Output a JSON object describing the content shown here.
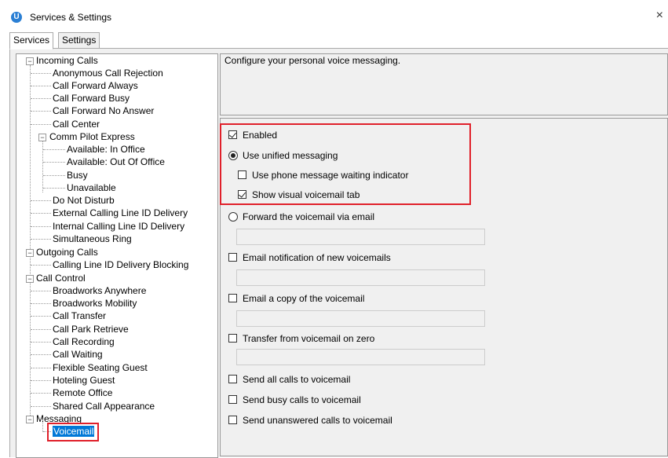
{
  "window": {
    "title": "Services & Settings",
    "icon": "app-logo-icon",
    "close_glyph": "×"
  },
  "tabs": [
    {
      "label": "Services",
      "active": true
    },
    {
      "label": "Settings",
      "active": false
    }
  ],
  "tree": {
    "incoming": {
      "label": "Incoming Calls",
      "items": [
        "Anonymous Call Rejection",
        "Call Forward Always",
        "Call Forward Busy",
        "Call Forward No Answer",
        "Call Center"
      ],
      "comm_pilot": {
        "label": "Comm Pilot Express",
        "items": [
          "Available: In Office",
          "Available: Out Of Office",
          "Busy",
          "Unavailable"
        ]
      },
      "items_after": [
        "Do Not Disturb",
        "External Calling Line ID Delivery",
        "Internal Calling Line ID Delivery",
        "Simultaneous Ring"
      ]
    },
    "outgoing": {
      "label": "Outgoing Calls",
      "items": [
        "Calling Line ID Delivery Blocking"
      ]
    },
    "call_control": {
      "label": "Call Control",
      "items": [
        "Broadworks Anywhere",
        "Broadworks Mobility",
        "Call Transfer",
        "Call Park Retrieve",
        "Call Recording",
        "Call Waiting",
        "Flexible Seating Guest",
        "Hoteling Guest",
        "Remote Office",
        "Shared Call Appearance"
      ]
    },
    "messaging": {
      "label": "Messaging",
      "items": [
        "Voicemail"
      ]
    }
  },
  "description": "Configure your personal voice messaging.",
  "settings": {
    "enabled": {
      "label": "Enabled",
      "checked": true
    },
    "use_unified": {
      "label": "Use unified messaging",
      "selected": true
    },
    "phone_mwi": {
      "label": "Use phone message waiting indicator",
      "checked": false
    },
    "visual_vm": {
      "label": "Show visual voicemail tab",
      "checked": true
    },
    "forward_email": {
      "label": "Forward the voicemail via email",
      "selected": false,
      "value": ""
    },
    "email_notify": {
      "label": "Email notification of new voicemails",
      "checked": false,
      "value": ""
    },
    "email_copy": {
      "label": "Email a copy of the voicemail",
      "checked": false,
      "value": ""
    },
    "transfer_zero": {
      "label": "Transfer from voicemail on zero",
      "checked": false,
      "value": ""
    },
    "send_all": {
      "label": "Send all calls to voicemail",
      "checked": false
    },
    "send_busy": {
      "label": "Send busy calls to voicemail",
      "checked": false
    },
    "send_unanswered": {
      "label": "Send unanswered calls to voicemail",
      "checked": false
    }
  },
  "colors": {
    "highlight_red": "#e0202a",
    "selection_blue": "#0078d7",
    "panel_gray": "#f0f0f0"
  }
}
